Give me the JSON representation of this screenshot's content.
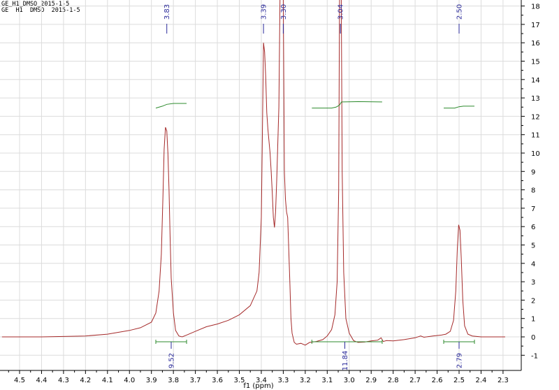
{
  "header": {
    "line1": "GE_H1_DMSO_2015-1-5",
    "line2": "GE  H1  DMSO  2015-1-5"
  },
  "chart_data": {
    "type": "line",
    "title": "",
    "xlabel": "f1 (ppm)",
    "ylabel": "",
    "xlim": [
      4.58,
      2.29
    ],
    "ylim": [
      -1.7,
      18.4
    ],
    "x_reversed": true,
    "grid": true,
    "x_ticks": [
      4.5,
      4.4,
      4.3,
      4.2,
      4.1,
      4.0,
      3.9,
      3.8,
      3.7,
      3.6,
      3.5,
      3.4,
      3.3,
      3.2,
      3.1,
      3.0,
      2.9,
      2.8,
      2.7,
      2.6,
      2.5,
      2.4,
      2.3
    ],
    "x_tick_labels": [
      "4.5",
      "4.4",
      "4.3",
      "4.2",
      "4.1",
      "4.0",
      "3.9",
      "3.8",
      "3.7",
      "3.6",
      "3.5",
      "3.4",
      "3.3",
      "3.2",
      "3.1",
      "3.0",
      "2.9",
      "2.8",
      "2.7",
      "2.6",
      "2.5",
      "2.4",
      "2.3"
    ],
    "y_ticks": [
      -1,
      0,
      1,
      2,
      3,
      4,
      5,
      6,
      7,
      8,
      9,
      10,
      11,
      12,
      13,
      14,
      15,
      16,
      17,
      18
    ],
    "y_tick_labels": [
      "-1",
      "0",
      "1",
      "2",
      "3",
      "4",
      "5",
      "6",
      "7",
      "8",
      "9",
      "10",
      "11",
      "12",
      "13",
      "14",
      "15",
      "16",
      "17",
      "18"
    ],
    "series": [
      {
        "color": "#a52a2a",
        "points": [
          [
            4.58,
            0.0
          ],
          [
            4.4,
            0.0
          ],
          [
            4.2,
            0.05
          ],
          [
            4.1,
            0.15
          ],
          [
            4.0,
            0.35
          ],
          [
            3.95,
            0.5
          ],
          [
            3.9,
            0.8
          ],
          [
            3.88,
            1.3
          ],
          [
            3.865,
            2.5
          ],
          [
            3.855,
            4.5
          ],
          [
            3.848,
            7.5
          ],
          [
            3.842,
            10.2
          ],
          [
            3.836,
            11.4
          ],
          [
            3.83,
            11.2
          ],
          [
            3.825,
            10.0
          ],
          [
            3.82,
            8.0
          ],
          [
            3.815,
            5.5
          ],
          [
            3.81,
            3.2
          ],
          [
            3.8,
            1.3
          ],
          [
            3.79,
            0.35
          ],
          [
            3.775,
            0.05
          ],
          [
            3.76,
            0.0
          ],
          [
            3.74,
            0.1
          ],
          [
            3.7,
            0.3
          ],
          [
            3.65,
            0.55
          ],
          [
            3.6,
            0.7
          ],
          [
            3.55,
            0.9
          ],
          [
            3.5,
            1.2
          ],
          [
            3.45,
            1.7
          ],
          [
            3.42,
            2.5
          ],
          [
            3.41,
            3.5
          ],
          [
            3.4,
            6.5
          ],
          [
            3.395,
            11.0
          ],
          [
            3.39,
            16.0
          ],
          [
            3.385,
            15.5
          ],
          [
            3.38,
            14.2
          ],
          [
            3.375,
            12.2
          ],
          [
            3.37,
            11.3
          ],
          [
            3.36,
            10.0
          ],
          [
            3.355,
            9.0
          ],
          [
            3.35,
            7.8
          ],
          [
            3.345,
            6.5
          ],
          [
            3.34,
            5.95
          ],
          [
            3.335,
            6.8
          ],
          [
            3.33,
            8.5
          ],
          [
            3.32,
            12.5
          ],
          [
            3.315,
            18.4
          ],
          [
            3.3,
            18.4
          ],
          [
            3.295,
            9.0
          ],
          [
            3.29,
            7.5
          ],
          [
            3.285,
            6.8
          ],
          [
            3.28,
            6.5
          ],
          [
            3.27,
            3.0
          ],
          [
            3.265,
            1.0
          ],
          [
            3.26,
            0.2
          ],
          [
            3.25,
            -0.3
          ],
          [
            3.24,
            -0.4
          ],
          [
            3.22,
            -0.35
          ],
          [
            3.2,
            -0.45
          ],
          [
            3.18,
            -0.3
          ],
          [
            3.15,
            -0.25
          ],
          [
            3.12,
            -0.15
          ],
          [
            3.1,
            0.05
          ],
          [
            3.08,
            0.4
          ],
          [
            3.065,
            1.2
          ],
          [
            3.055,
            3.0
          ],
          [
            3.048,
            8.0
          ],
          [
            3.044,
            18.4
          ],
          [
            3.036,
            18.4
          ],
          [
            3.032,
            9.0
          ],
          [
            3.025,
            3.5
          ],
          [
            3.015,
            1.0
          ],
          [
            3.0,
            0.2
          ],
          [
            2.98,
            -0.2
          ],
          [
            2.96,
            -0.3
          ],
          [
            2.93,
            -0.28
          ],
          [
            2.9,
            -0.22
          ],
          [
            2.87,
            -0.18
          ],
          [
            2.855,
            -0.05
          ],
          [
            2.845,
            -0.25
          ],
          [
            2.83,
            -0.2
          ],
          [
            2.8,
            -0.22
          ],
          [
            2.75,
            -0.15
          ],
          [
            2.7,
            -0.05
          ],
          [
            2.675,
            0.05
          ],
          [
            2.66,
            -0.02
          ],
          [
            2.62,
            0.05
          ],
          [
            2.58,
            0.1
          ],
          [
            2.56,
            0.15
          ],
          [
            2.54,
            0.3
          ],
          [
            2.525,
            0.9
          ],
          [
            2.515,
            2.5
          ],
          [
            2.508,
            4.8
          ],
          [
            2.502,
            6.1
          ],
          [
            2.496,
            5.8
          ],
          [
            2.49,
            4.3
          ],
          [
            2.483,
            2.0
          ],
          [
            2.475,
            0.6
          ],
          [
            2.46,
            0.15
          ],
          [
            2.44,
            0.05
          ],
          [
            2.4,
            0.0
          ],
          [
            2.29,
            0.0
          ]
        ]
      }
    ],
    "peaks": [
      {
        "x": 3.83,
        "label": "3.83"
      },
      {
        "x": 3.39,
        "label": "3.39"
      },
      {
        "x": 3.3,
        "label": "3.30"
      },
      {
        "x": 3.04,
        "label": "3.04"
      },
      {
        "x": 2.5,
        "label": "2.50"
      }
    ],
    "integrals": [
      {
        "from": 3.88,
        "to": 3.74,
        "center": 3.81,
        "value": "9.52",
        "curve": [
          [
            3.88,
            12.45
          ],
          [
            3.85,
            12.55
          ],
          [
            3.83,
            12.65
          ],
          [
            3.8,
            12.7
          ],
          [
            3.74,
            12.7
          ]
        ]
      },
      {
        "from": 3.17,
        "to": 2.85,
        "center": 3.02,
        "value": "11.84",
        "curve": [
          [
            3.17,
            12.45
          ],
          [
            3.08,
            12.45
          ],
          [
            3.06,
            12.5
          ],
          [
            3.045,
            12.6
          ],
          [
            3.035,
            12.78
          ],
          [
            2.96,
            12.8
          ],
          [
            2.85,
            12.78
          ]
        ]
      },
      {
        "from": 2.57,
        "to": 2.43,
        "center": 2.5,
        "value": "2.79",
        "curve": [
          [
            2.57,
            12.45
          ],
          [
            2.52,
            12.45
          ],
          [
            2.5,
            12.52
          ],
          [
            2.48,
            12.55
          ],
          [
            2.43,
            12.55
          ]
        ]
      }
    ],
    "colors": {
      "spectrum": "#a52a2a",
      "integral": "#2e8b2e",
      "peak_label": "#2a2a9a",
      "grid": "#dcdcdc",
      "axis": "#000000"
    }
  }
}
